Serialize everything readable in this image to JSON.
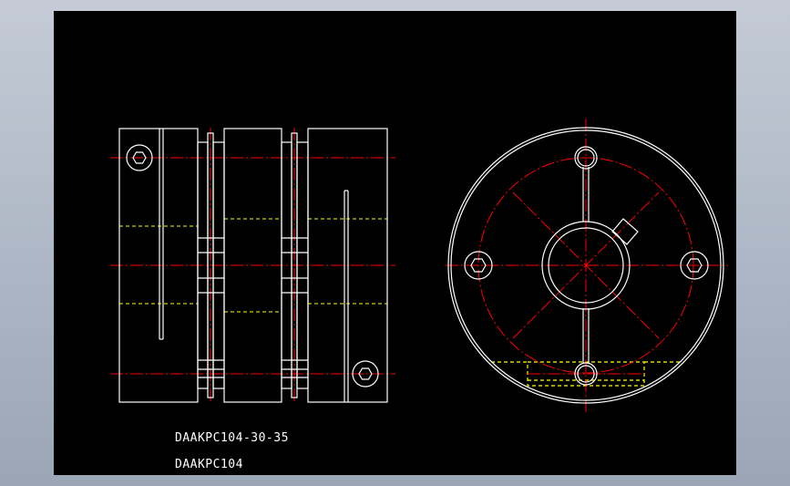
{
  "drawing": {
    "part_number": "DAAKPC104-30-35",
    "series": "DAAKPC104"
  },
  "colors": {
    "background": "#000000",
    "outline": "#ffffff",
    "centerline": "#ff0000",
    "hidden": "#ffff00",
    "frame": "#9aa5b6"
  }
}
